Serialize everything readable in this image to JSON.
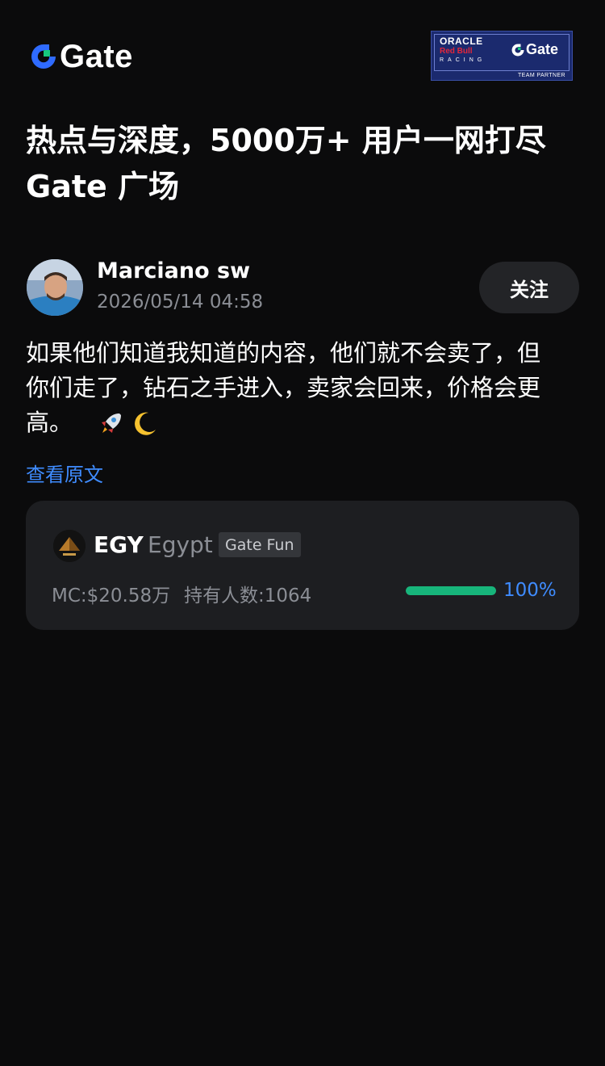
{
  "header": {
    "logo_text": "Gate",
    "partner": {
      "oracle": "ORACLE",
      "redbull": "Red Bull",
      "racing": "RACING",
      "gate": "Gate",
      "team_partner": "TEAM PARTNER"
    }
  },
  "hero": {
    "title_line1": "热点与深度，5000万+ 用户一网打尽",
    "title_line2": "Gate 广场"
  },
  "post": {
    "author": "Marciano sw",
    "time": "2026/05/14 04:58",
    "follow_label": "关注",
    "body_line1": "如果他们知道我知道的内容，他们就不会卖了，但",
    "body_line2": "你们走了，钻石之手进入，卖家会回来，价格会更",
    "body_line3": "高。",
    "view_original": "查看原文"
  },
  "token": {
    "symbol": "EGY",
    "name": "Egypt",
    "tag": "Gate Fun",
    "market_cap": "MC:$20.58万",
    "holders": "持有人数:1064",
    "progress": 1.0,
    "progress_text": "100%"
  },
  "colors": {
    "background": "#0b0b0c",
    "card": "#1d1e21",
    "accent_blue": "#3f8cff",
    "progress_green": "#17b57b",
    "muted_text": "#8b8e95"
  }
}
